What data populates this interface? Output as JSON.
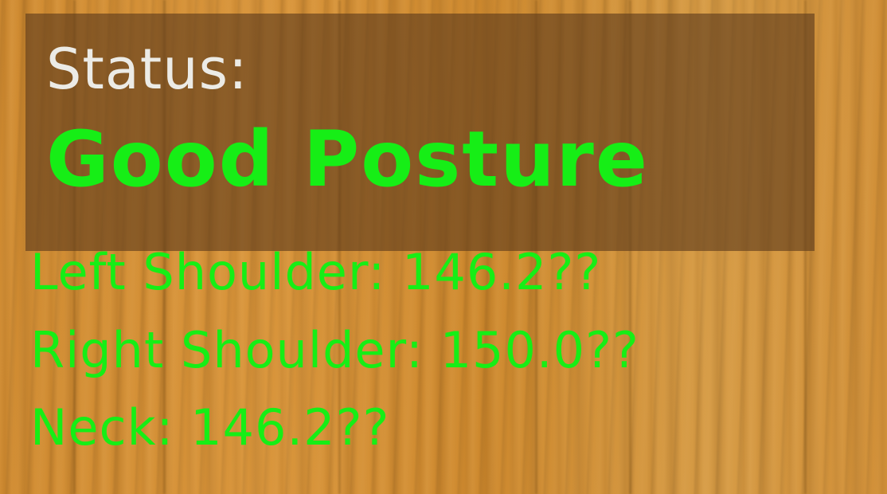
{
  "overlay": {
    "status_label": "Status:",
    "status_value": "Good Posture",
    "metrics": [
      {
        "text": "Left Shoulder: 146.2??"
      },
      {
        "text": "Right Shoulder: 150.0??"
      },
      {
        "text": "Neck: 146.2??"
      }
    ]
  },
  "colors": {
    "status_good": "#16ee16",
    "label_text": "#ecebe6",
    "panel_bg": "#5c3a1c",
    "background_wood": "#d08e36"
  }
}
